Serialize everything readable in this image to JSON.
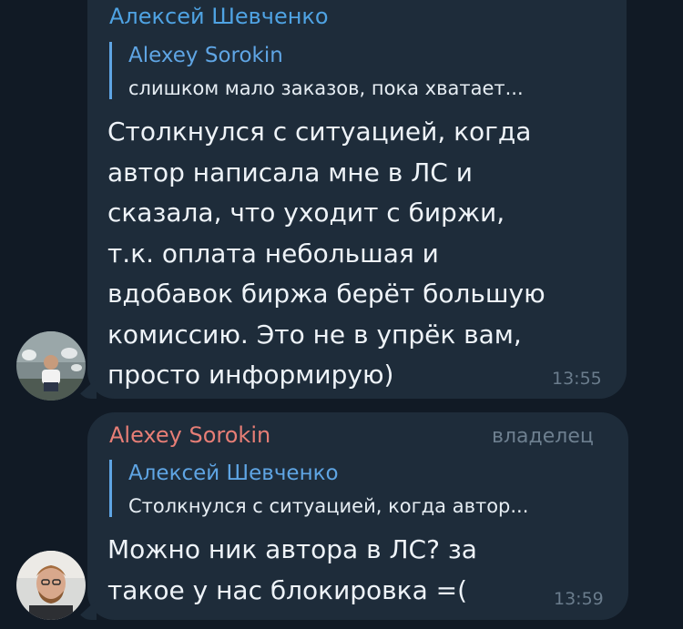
{
  "messages": [
    {
      "sender": "Алексей Шевченко",
      "sender_color": "#4fa3e3",
      "reply_author": "Alexey Sorokin",
      "reply_snippet": "слишком мало заказов, пока хватает...",
      "text": "Столкнулся с ситуацией, когда\nавтор написала мне в ЛС и\nсказала, что уходит с биржи,\nт.к. оплата небольшая и\nвдобавок биржа берёт большую\nкомиссию. Это не в упрёк вам,\nпросто информирую)",
      "time": "13:55",
      "avatar": "avatar-photo"
    },
    {
      "sender": "Alexey Sorokin",
      "sender_color": "#e77e76",
      "role": "владелец",
      "reply_author": "Алексей Шевченко",
      "reply_snippet": "Столкнулся с ситуацией, когда автор...",
      "text": "Можно ник автора в ЛС? за\nтакое у нас блокировка =(",
      "time": "13:59",
      "avatar": "avatar-photo"
    }
  ],
  "colors": {
    "background": "#111a25",
    "bubble": "#1e2c3a",
    "reply_accent": "#5fa5e4",
    "text": "#eef3f8",
    "meta": "#6a7c8c"
  }
}
